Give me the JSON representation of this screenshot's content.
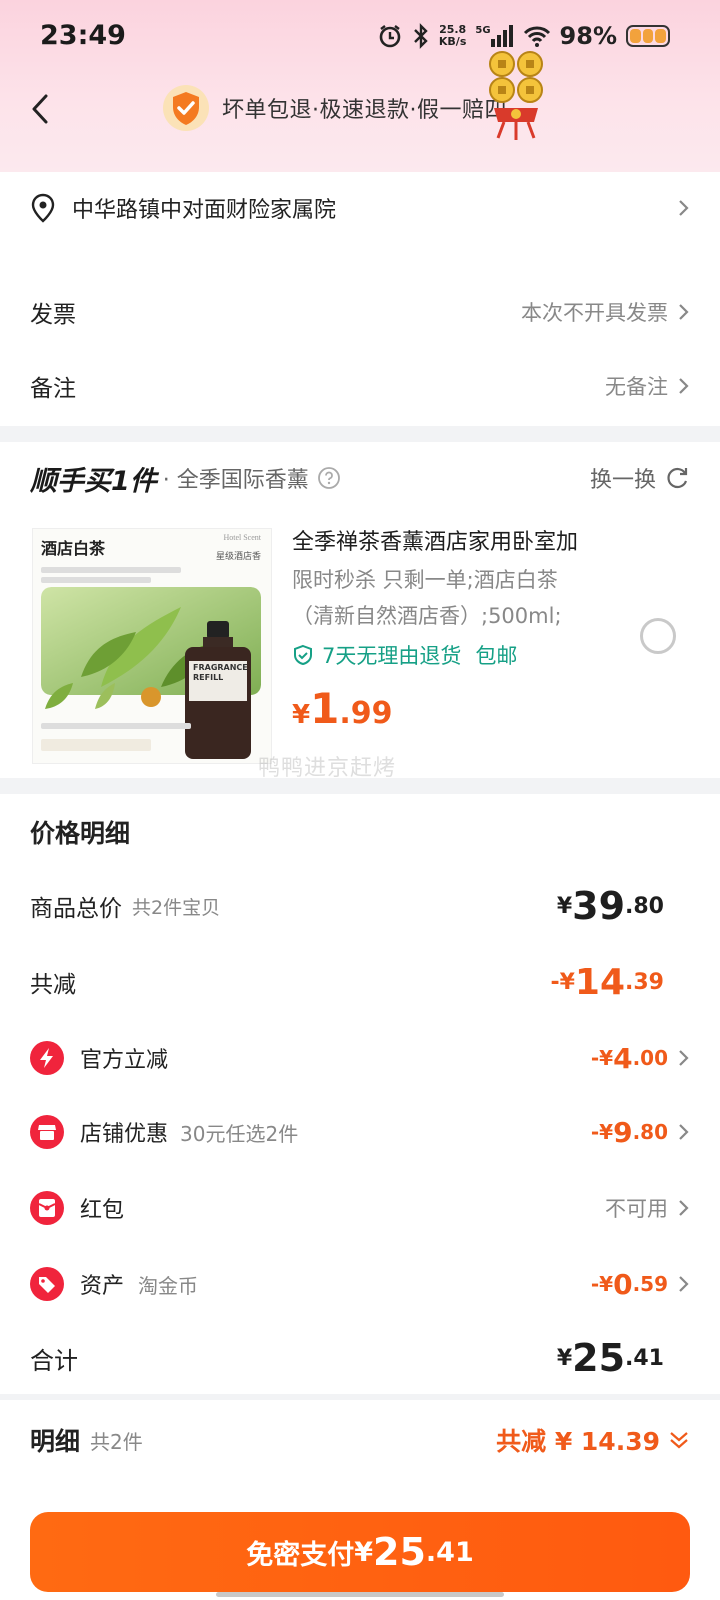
{
  "status_bar": {
    "time": "23:49",
    "net_speed_value": "25.8",
    "net_speed_unit": "KB/s",
    "network_type": "5G",
    "battery": "98%"
  },
  "header": {
    "promise_text": "坏单包退·极速退款·假一赔四"
  },
  "address": {
    "text": "中华路镇中对面财险家属院"
  },
  "invoice": {
    "label": "发票",
    "value": "本次不开具发票"
  },
  "remark": {
    "label": "备注",
    "value": "无备注"
  },
  "addon": {
    "title": "顺手买1件",
    "subtitle": "· 全季国际香薰",
    "refresh_label": "换一换",
    "product": {
      "title": "全季禅茶香薰酒店家用卧室加",
      "desc_line1": "限时秒杀 只剩一单;酒店白茶",
      "desc_line2": "（清新自然酒店香）;500ml;",
      "guarantee": "7天无理由退货",
      "shipping": "包邮",
      "price_symbol": "¥",
      "price_int": "1",
      "price_dec": ".99",
      "image_heading": "酒店白茶",
      "image_subheading": "星级酒店香",
      "image_brand": "Hotel Scent",
      "image_bottle_label": "FRAGRANCE REFILL"
    },
    "watermark": "鸭鸭进京赶烤"
  },
  "price_detail": {
    "title": "价格明细",
    "total_goods": {
      "label": "商品总价",
      "sub": "共2件宝贝",
      "symbol": "¥",
      "int": "39",
      "dec": ".80"
    },
    "total_discount": {
      "label": "共减",
      "symbol": "-¥",
      "int": "14",
      "dec": ".39"
    },
    "official": {
      "label": "官方立减",
      "symbol": "-¥",
      "int": "4",
      "dec": ".00"
    },
    "store": {
      "label": "店铺优惠",
      "sub": "30元任选2件",
      "symbol": "-¥",
      "int": "9",
      "dec": ".80"
    },
    "redpacket": {
      "label": "红包",
      "value": "不可用"
    },
    "asset": {
      "label": "资产",
      "sub": "淘金币",
      "symbol": "-¥",
      "int": "0",
      "dec": ".59"
    },
    "sum": {
      "label": "合计",
      "symbol": "¥",
      "int": "25",
      "dec": ".41"
    }
  },
  "bottom": {
    "label": "明细",
    "count": "共2件",
    "discount_text": "共减 ¥ 14.39",
    "pay_label": "免密支付",
    "pay_symbol": "¥",
    "pay_int": "25",
    "pay_dec": ".41"
  },
  "colors": {
    "accent": "#f05a1a",
    "red_icon": "#f0243c",
    "green": "#16a086",
    "header_pink": "#fbd3de"
  }
}
